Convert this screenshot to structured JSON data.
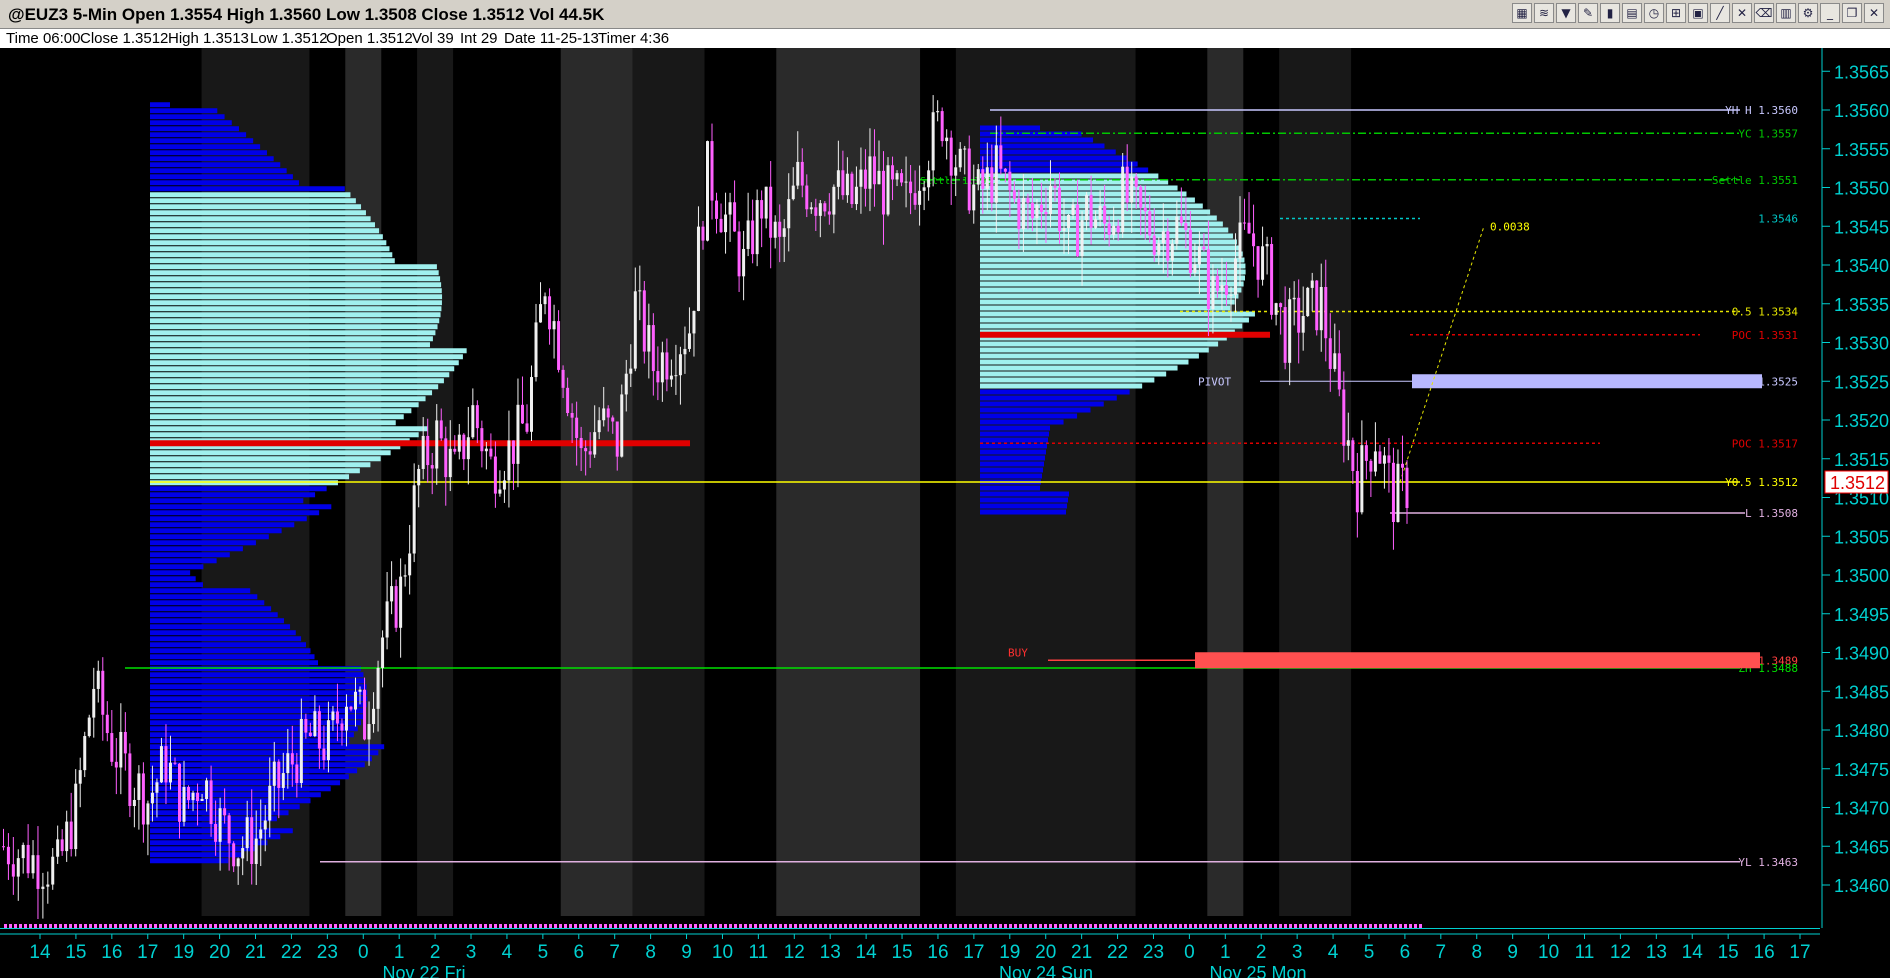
{
  "window": {
    "title": "@EUZ3 5-Min Open 1.3554 High 1.3560 Low 1.3508 Close 1.3512 Vol 44.5K",
    "toolbar_icons": [
      "chart-icon",
      "waves-icon",
      "filter-icon",
      "pencil-icon",
      "bars-icon",
      "profile-icon",
      "clock-icon",
      "symbol-icon",
      "data-icon",
      "trendline-icon",
      "cross-icon",
      "delete-icon",
      "trash-icon",
      "settings-icon",
      "minimize-icon",
      "restore-icon",
      "close-icon"
    ]
  },
  "infobar": {
    "time": "Time 06:00",
    "close": "Close 1.3512",
    "high": "High 1.3513",
    "low": "Low 1.3512",
    "open": "Open 1.3512",
    "vol": "Vol 39",
    "int": "Int 29",
    "date": "Date 11-25-13",
    "timer": "Timer 4:36"
  },
  "chart_data": {
    "type": "candlestick",
    "symbol": "@EUZ3",
    "interval": "5-Min",
    "ylim": [
      1.3456,
      1.3568
    ],
    "y_ticks": [
      "1.3460",
      "1.3465",
      "1.3470",
      "1.3475",
      "1.3480",
      "1.3485",
      "1.3490",
      "1.3495",
      "1.3500",
      "1.3505",
      "1.3510",
      "1.3515",
      "1.3520",
      "1.3525",
      "1.3530",
      "1.3535",
      "1.3540",
      "1.3545",
      "1.3550",
      "1.3555",
      "1.3560",
      "1.3565"
    ],
    "x_ticks": [
      "14",
      "15",
      "16",
      "17",
      "19",
      "20",
      "21",
      "22",
      "23",
      "0",
      "1",
      "2",
      "3",
      "4",
      "5",
      "6",
      "7",
      "8",
      "9",
      "10",
      "11",
      "12",
      "13",
      "14",
      "15",
      "16",
      "17",
      "19",
      "20",
      "21",
      "22",
      "23",
      "0",
      "1",
      "2",
      "3",
      "4",
      "5",
      "6",
      "7",
      "8",
      "9",
      "10",
      "11",
      "12",
      "13",
      "14",
      "15",
      "16",
      "17"
    ],
    "day_labels": [
      "Nov 22 Fri",
      "Nov 24 Sun",
      "Nov 25 Mon"
    ],
    "current_price": "1.3512",
    "price_path": [
      [
        0,
        1.3465
      ],
      [
        3,
        1.3462
      ],
      [
        4,
        1.347
      ],
      [
        5,
        1.3486
      ],
      [
        6,
        1.3478
      ],
      [
        7,
        1.3474
      ],
      [
        8,
        1.3471
      ],
      [
        9,
        1.3476
      ],
      [
        10,
        1.347
      ],
      [
        11,
        1.3474
      ],
      [
        12,
        1.3468
      ],
      [
        13,
        1.3465
      ],
      [
        14,
        1.3466
      ],
      [
        15,
        1.3472
      ],
      [
        16,
        1.3476
      ],
      [
        17,
        1.3479
      ],
      [
        18,
        1.3478
      ],
      [
        19,
        1.3485
      ],
      [
        20,
        1.3481
      ],
      [
        21,
        1.3492
      ],
      [
        22,
        1.3498
      ],
      [
        23,
        1.3513
      ],
      [
        24,
        1.3518
      ],
      [
        25,
        1.3513
      ],
      [
        26,
        1.3521
      ],
      [
        27,
        1.3514
      ],
      [
        28,
        1.3516
      ],
      [
        29,
        1.352
      ],
      [
        30,
        1.3538
      ],
      [
        31,
        1.3527
      ],
      [
        32,
        1.3515
      ],
      [
        33,
        1.352
      ],
      [
        34,
        1.3517
      ],
      [
        35,
        1.3535
      ],
      [
        36,
        1.3527
      ],
      [
        37,
        1.3529
      ],
      [
        38,
        1.3532
      ],
      [
        39,
        1.3552
      ],
      [
        40,
        1.3546
      ],
      [
        41,
        1.354
      ],
      [
        42,
        1.3548
      ],
      [
        43,
        1.3542
      ],
      [
        44,
        1.3551
      ],
      [
        45,
        1.3549
      ],
      [
        46,
        1.355
      ],
      [
        47,
        1.3548
      ],
      [
        48,
        1.3552
      ],
      [
        49,
        1.3549
      ],
      [
        50,
        1.3548
      ],
      [
        51,
        1.3554
      ],
      [
        52,
        1.3559
      ],
      [
        53,
        1.3552
      ],
      [
        54,
        1.3549
      ],
      [
        55,
        1.3552
      ],
      [
        56,
        1.3548
      ],
      [
        57,
        1.3546
      ],
      [
        58,
        1.3551
      ],
      [
        59,
        1.3543
      ],
      [
        60,
        1.3547
      ],
      [
        61,
        1.3545
      ],
      [
        62,
        1.3549
      ],
      [
        63,
        1.3546
      ],
      [
        64,
        1.3544
      ],
      [
        65,
        1.3545
      ],
      [
        66,
        1.3542
      ],
      [
        67,
        1.3536
      ],
      [
        68,
        1.354
      ],
      [
        69,
        1.3544
      ],
      [
        70,
        1.3539
      ],
      [
        71,
        1.3531
      ],
      [
        72,
        1.3534
      ],
      [
        73,
        1.3535
      ],
      [
        74,
        1.3522
      ],
      [
        75,
        1.3512
      ],
      [
        76,
        1.3518
      ],
      [
        77,
        1.351
      ],
      [
        78,
        1.3512
      ]
    ],
    "annotations": [
      {
        "label": "YH H 1.3560",
        "price": 1.356,
        "color": "#c8c8ff",
        "style": "solid"
      },
      {
        "label": "YC 1.3557",
        "price": 1.3557,
        "color": "#00c800",
        "style": "dashdot"
      },
      {
        "label": "Settle 1.3551",
        "price": 1.3551,
        "color": "#00c800",
        "style": "dashdot"
      },
      {
        "label": "1.3546",
        "price": 1.3546,
        "color": "#00c8c8",
        "style": "dotted"
      },
      {
        "label": "0.5 1.3534",
        "price": 1.3534,
        "color": "#e6e600",
        "style": "dotted"
      },
      {
        "label": "POC 1.3531",
        "price": 1.3531,
        "color": "#e00000",
        "style": "dotted"
      },
      {
        "label": "1.3525",
        "price": 1.3525,
        "color": "#c8c8ff",
        "style": "solid"
      },
      {
        "label": "POC 1.3517",
        "price": 1.3517,
        "color": "#e00000",
        "style": "dotted"
      },
      {
        "label": "Y0.5 1.3512",
        "price": 1.3512,
        "color": "#ffff00",
        "style": "solid"
      },
      {
        "label": "L 1.3508",
        "price": 1.3508,
        "color": "#e0b0e0",
        "style": "solid"
      },
      {
        "label": "1.3489",
        "price": 1.3489,
        "color": "#ff4040",
        "style": "solid"
      },
      {
        "label": "ZH 1.3488",
        "price": 1.3488,
        "color": "#00e000",
        "style": "solid"
      },
      {
        "label": "YL 1.3463",
        "price": 1.3463,
        "color": "#e0b0e0",
        "style": "solid"
      }
    ],
    "text_labels": {
      "pivot": "PIVOT",
      "buy": "BUY",
      "settle_small": "Settle 1.3551",
      "range": "0.0038"
    }
  },
  "colors": {
    "up": "#f0f0f0",
    "down": "#ff60ff",
    "value_area": "#a0f0ee",
    "outside_area": "#0000e8",
    "poc": "#e00000",
    "axis": "#00d0d0",
    "background": "#000000"
  }
}
